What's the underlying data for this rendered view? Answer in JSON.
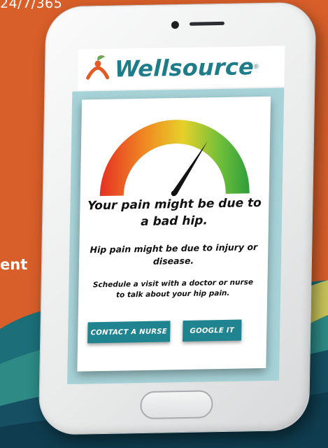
{
  "background": {
    "color": "#d95f2a",
    "corner_text": "24/7/365",
    "side_text": "ent"
  },
  "app": {
    "brand_name": "Wellsource",
    "brand_mark": "®",
    "brand_color": "#1f7d89",
    "logo_icon": "person-leaf-icon"
  },
  "screen": {
    "gauge_icon": "pain-gauge-icon",
    "headline": "Your pain might be due to a bad hip.",
    "subtext": "Hip pain might be due to injury or disease.",
    "instruction": "Schedule a visit with a doctor or nurse to talk about your hip pain.",
    "buttons": {
      "contact_nurse": "CONTACT A NURSE",
      "google_it": "GOOGLE IT"
    },
    "button_color": "#1f8390",
    "panel_color": "#a7d3d8"
  }
}
